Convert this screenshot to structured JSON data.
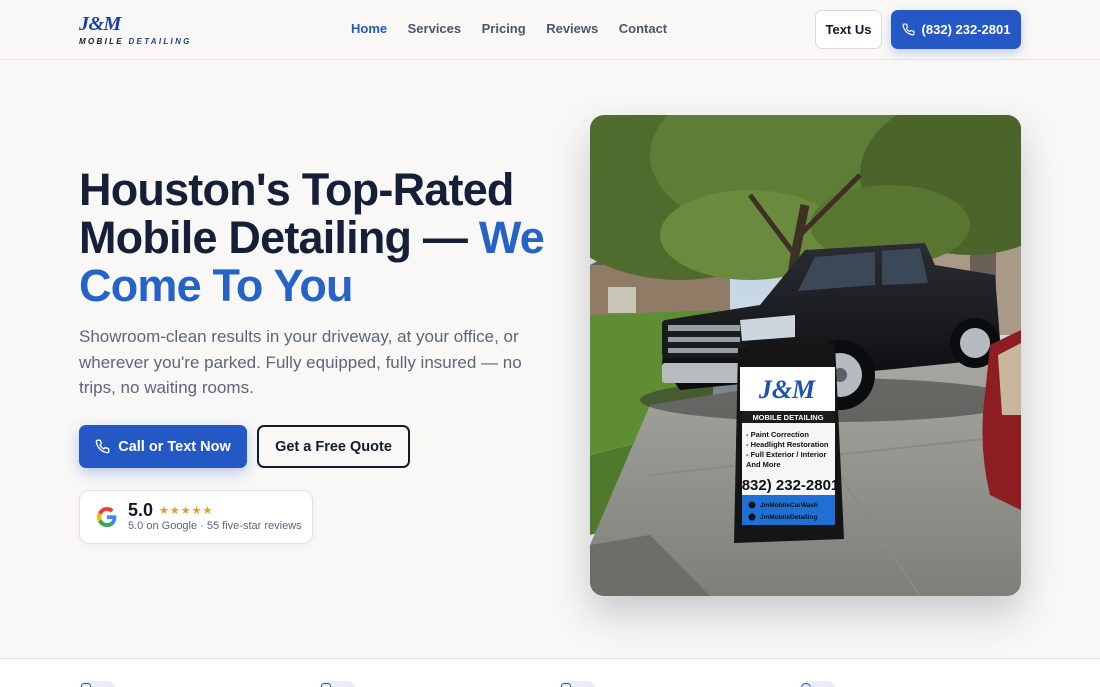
{
  "brand": {
    "logo_main": "J&M",
    "logo_sub_1": "MOBILE",
    "logo_sub_2": "DETAILING"
  },
  "nav": {
    "items": [
      "Home",
      "Services",
      "Pricing",
      "Reviews",
      "Contact"
    ],
    "active": "Home"
  },
  "header_actions": {
    "text_us": "Text Us",
    "phone": "(832) 232-2801"
  },
  "hero": {
    "title_line_1": "Houston's Top-Rated",
    "title_line_2": "Mobile Detailing —",
    "title_accent_1": "We",
    "title_accent_2": "Come To You",
    "subtitle": "Showroom-clean results in your driveway, at your office, or wherever you're parked. Fully equipped, fully insured — no trips, no waiting rooms.",
    "cta_primary": "Call or Text Now",
    "cta_secondary": "Get a Free Quote"
  },
  "review": {
    "rating": "5.0",
    "stars": "★★★★★",
    "source_line": "5.0 on Google · 55 five-star reviews"
  },
  "photo_sign": {
    "brand": "J&M",
    "script": "Mobile Detailing",
    "banner": "MOBILE DETAILING",
    "services": [
      "- Paint Correction",
      "- Headlight Restoration",
      "- Full Exterior / Interior",
      "  And More"
    ],
    "phone": "(832) 232-2801",
    "social_1": "JmMobileCarWash",
    "social_2": "JmMobileDetailing"
  },
  "colors": {
    "accent": "#2358c5",
    "accent_text": "#2563c6",
    "background": "#f9f8f6",
    "stars": "#e0a21a"
  },
  "icons": [
    "phone-icon",
    "google-icon",
    "star-icon"
  ]
}
